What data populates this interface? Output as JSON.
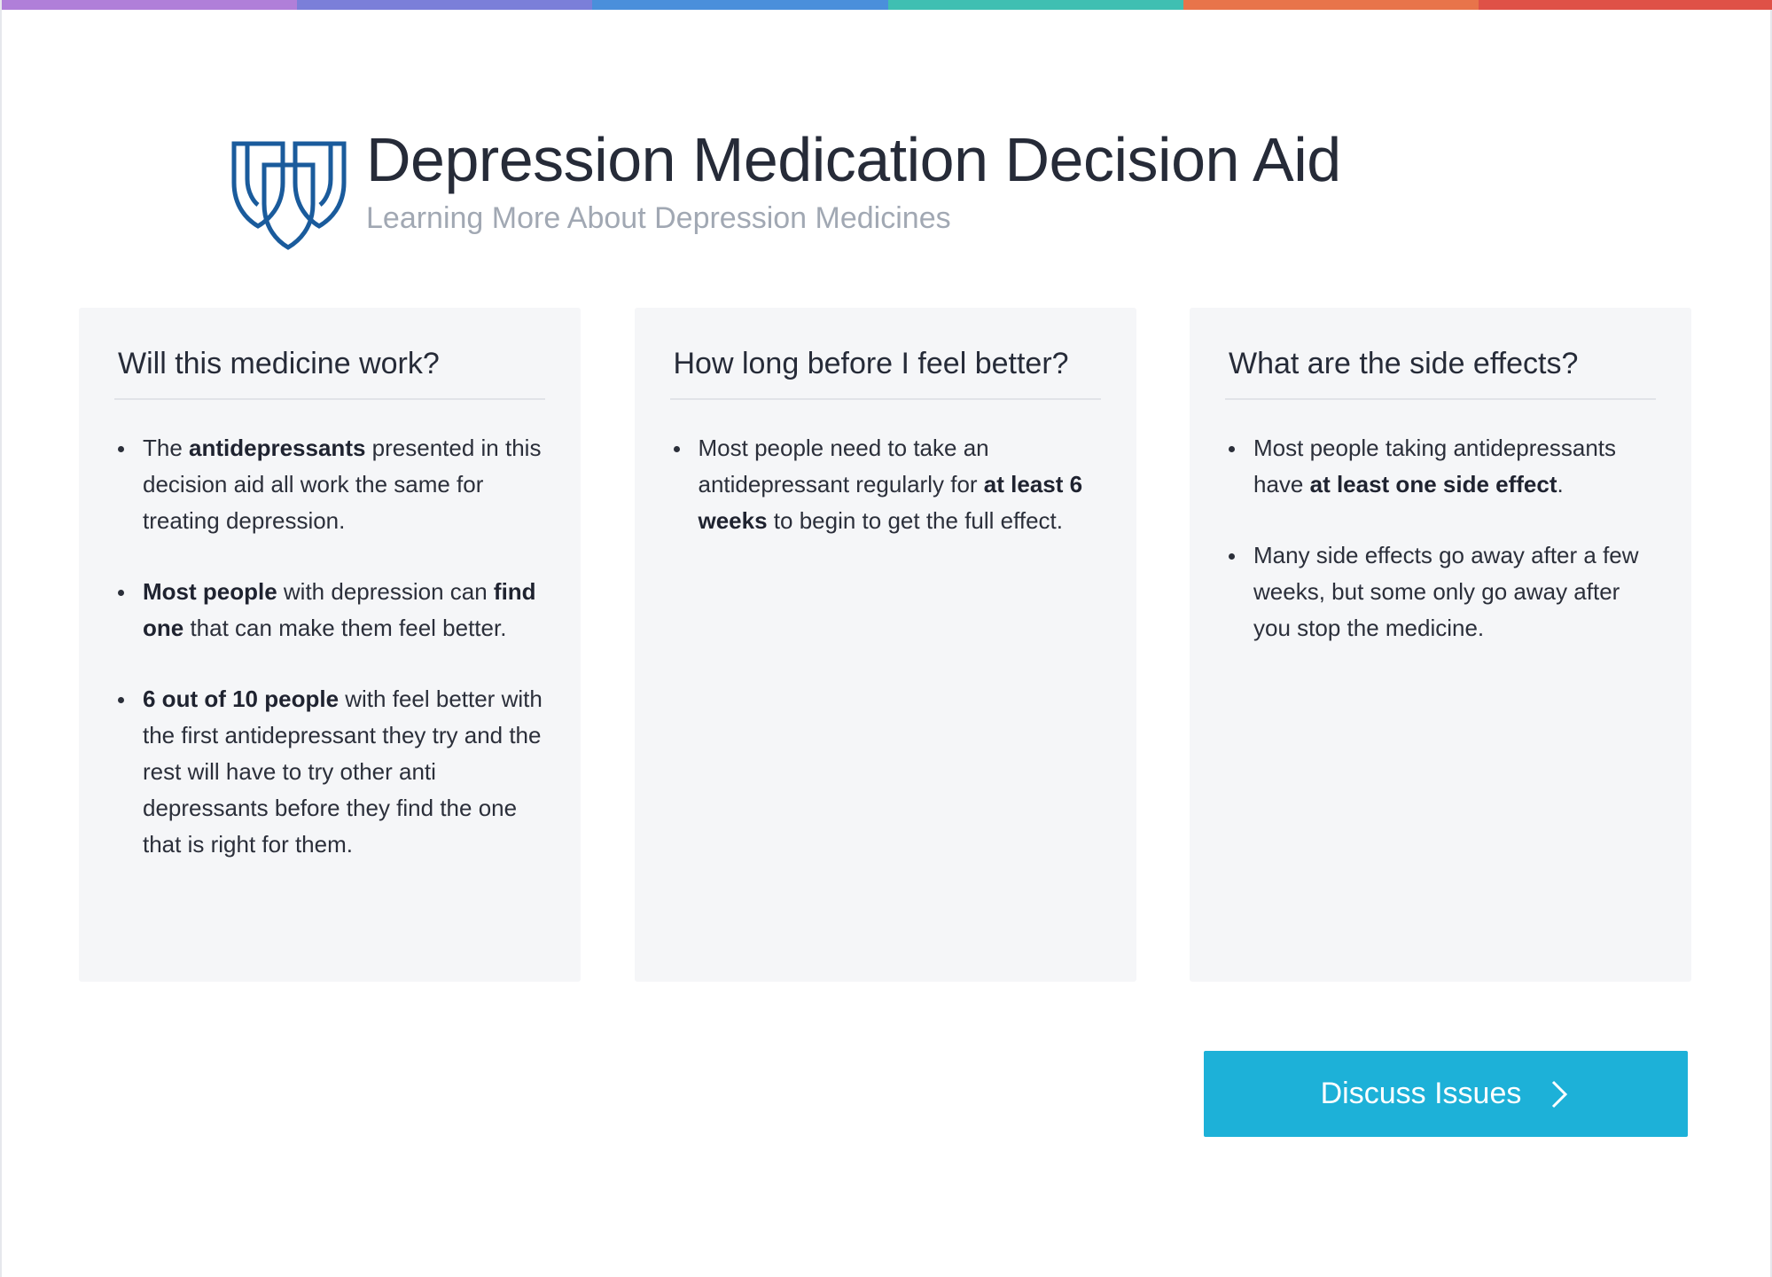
{
  "color_bar": [
    "#b07fd9",
    "#7b7fd9",
    "#4a8fdb",
    "#3fbfb2",
    "#e8744a",
    "#df5147"
  ],
  "header": {
    "title": "Depression Medication Decision Aid",
    "subtitle": "Learning More About Depression Medicines",
    "logo_icon": "twin-shields-logo-icon",
    "logo_color": "#1a5b9c"
  },
  "cards": [
    {
      "title": "Will this medicine work?",
      "bullets": [
        [
          {
            "t": "The "
          },
          {
            "t": "antidepressants",
            "b": true
          },
          {
            "t": " presented in this decision aid all work the same for treating depression."
          }
        ],
        [
          {
            "t": "Most people",
            "b": true
          },
          {
            "t": " with depression can "
          },
          {
            "t": "find one",
            "b": true
          },
          {
            "t": " that can make them feel better."
          }
        ],
        [
          {
            "t": "6 out of 10 people",
            "b": true
          },
          {
            "t": " with feel better with the first antidepressant they try and the rest will have to try other anti depressants before they find the one that is right for them."
          }
        ]
      ]
    },
    {
      "title": "How long before I feel better?",
      "bullets": [
        [
          {
            "t": "Most people need to take an antidepressant regularly for "
          },
          {
            "t": "at least 6 weeks",
            "b": true
          },
          {
            "t": " to begin to get the full effect."
          }
        ]
      ]
    },
    {
      "title": "What are the side effects?",
      "bullets": [
        [
          {
            "t": "Most people taking antidepressants have "
          },
          {
            "t": "at least one side effect",
            "b": true
          },
          {
            "t": "."
          }
        ],
        [
          {
            "t": "Many side effects go away after a few weeks, but some only go away after you stop the medicine."
          }
        ]
      ]
    }
  ],
  "cta": {
    "label": "Discuss Issues",
    "icon": "chevron-right-icon",
    "color": "#1db1d8"
  }
}
